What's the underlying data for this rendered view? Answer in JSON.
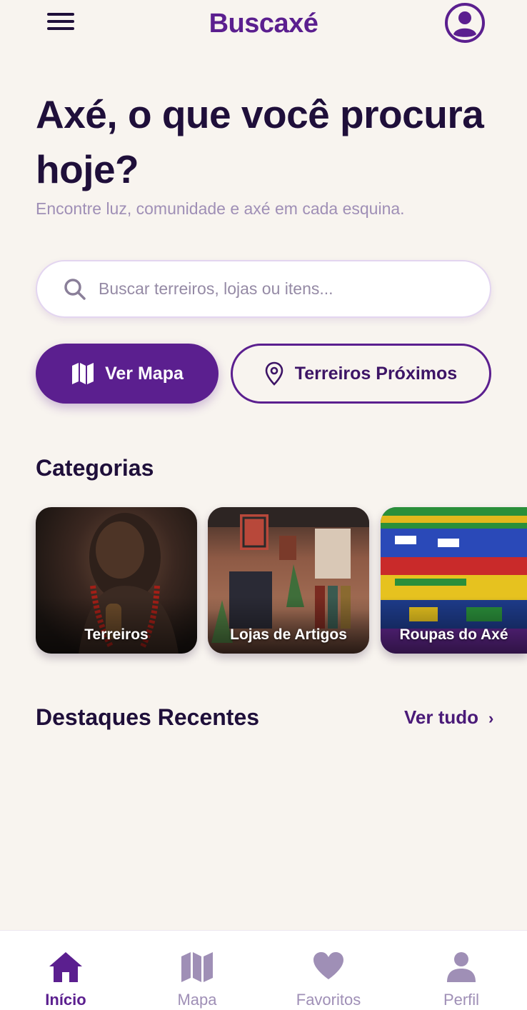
{
  "header": {
    "title": "Buscaxé",
    "menu_icon": "hamburger-menu-icon",
    "profile_icon": "user-circle-icon"
  },
  "hero": {
    "title": "Axé, o que você procura hoje?",
    "subtitle": "Encontre luz, comunidade e axé em cada esquina."
  },
  "search": {
    "placeholder": "Buscar terreiros, lojas ou itens...",
    "value": ""
  },
  "actions": {
    "map_label": "Ver Mapa",
    "nearby_label": "Terreiros Próximos"
  },
  "categories": {
    "title": "Categorias",
    "items": [
      {
        "label": "Terreiros"
      },
      {
        "label": "Lojas de Artigos"
      },
      {
        "label": "Roupas do Axé"
      }
    ]
  },
  "highlights": {
    "title": "Destaques Recentes",
    "see_all": "Ver tudo",
    "see_all_chevron": "›"
  },
  "bottom_nav": {
    "items": [
      {
        "label": "Início",
        "icon": "home-icon",
        "active": true
      },
      {
        "label": "Mapa",
        "icon": "map-icon",
        "active": false
      },
      {
        "label": "Favoritos",
        "icon": "heart-icon",
        "active": false
      },
      {
        "label": "Perfil",
        "icon": "person-icon",
        "active": false
      }
    ]
  },
  "colors": {
    "brand": "#5b1f8f",
    "background": "#f8f4ef",
    "text_dark": "#1f0f3a",
    "text_muted": "#9f8fb6"
  }
}
